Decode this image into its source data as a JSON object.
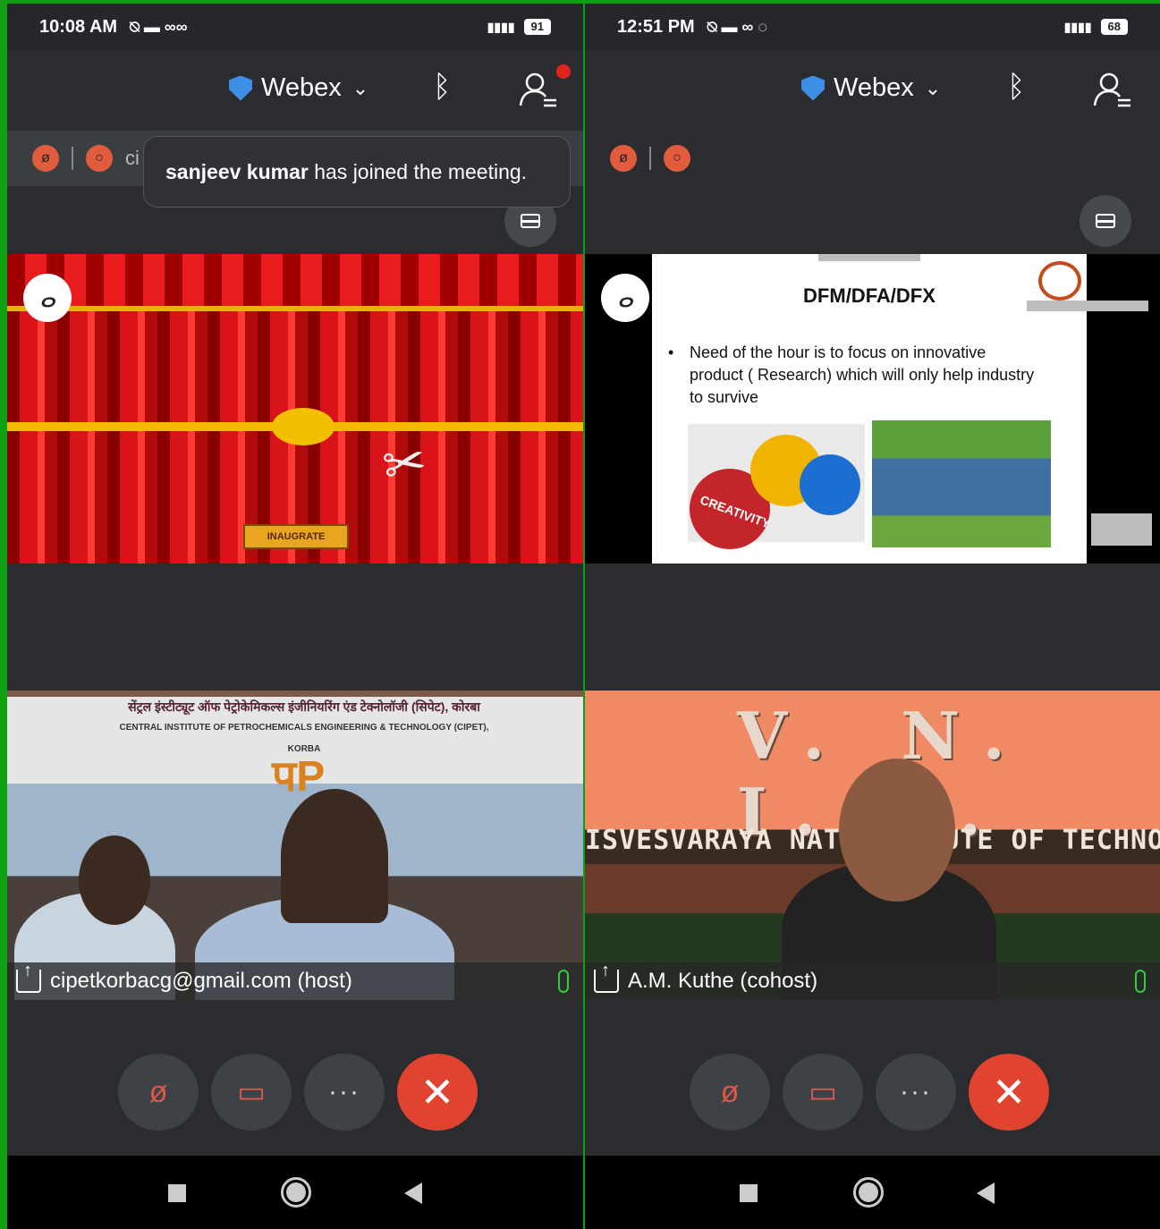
{
  "left": {
    "status": {
      "time": "10:08 AM",
      "battery": "91"
    },
    "topbar": {
      "app_name": "Webex"
    },
    "ctrl_text": "ci",
    "toast": {
      "name": "sanjeev kumar",
      "message": " has joined the meeting."
    },
    "share": {
      "button_label": "INAUGRATE"
    },
    "video": {
      "banner_hindi": "सेंट्रल इंस्टीट्यूट ऑफ पेट्रोकेमिकल्स इंजीनियरिंग एंड टेक्नोलॉजी (सिपेट), कोरबा",
      "banner_english": "CENTRAL INSTITUTE OF PETROCHEMICALS ENGINEERING & TECHNOLOGY (CIPET), KORBA",
      "participant": "cipetkorbacg@gmail.com (host)"
    }
  },
  "right": {
    "status": {
      "time": "12:51 PM",
      "battery": "68"
    },
    "topbar": {
      "app_name": "Webex"
    },
    "slide": {
      "title": "DFM/DFA/DFX",
      "bullet": "Need of the hour is to focus on innovative product ( Research) which will only help industry to survive",
      "gear_label": "CREATIVITY"
    },
    "video": {
      "sign_top": "V. N. I. T.",
      "sign_bottom": "ISVESVARAYA  NATIONAL      UTE OF TECHNOLOGY",
      "participant": "A.M. Kuthe (cohost)"
    }
  },
  "icons": [
    "shield-icon",
    "chevron-down-icon",
    "bluetooth-icon",
    "participants-icon",
    "mute-icon",
    "record-icon",
    "layout-icon",
    "annotation-icon",
    "share-icon",
    "mic-icon",
    "mute-lock-icon",
    "video-off-icon",
    "more-icon",
    "end-call-icon",
    "nav-recents-icon",
    "nav-home-icon",
    "nav-back-icon"
  ],
  "colors": {
    "end_call": "#e0432f",
    "mic_active": "#2ed03a",
    "accent_blue": "#3d8fe6",
    "background_green": "#0fa012"
  }
}
